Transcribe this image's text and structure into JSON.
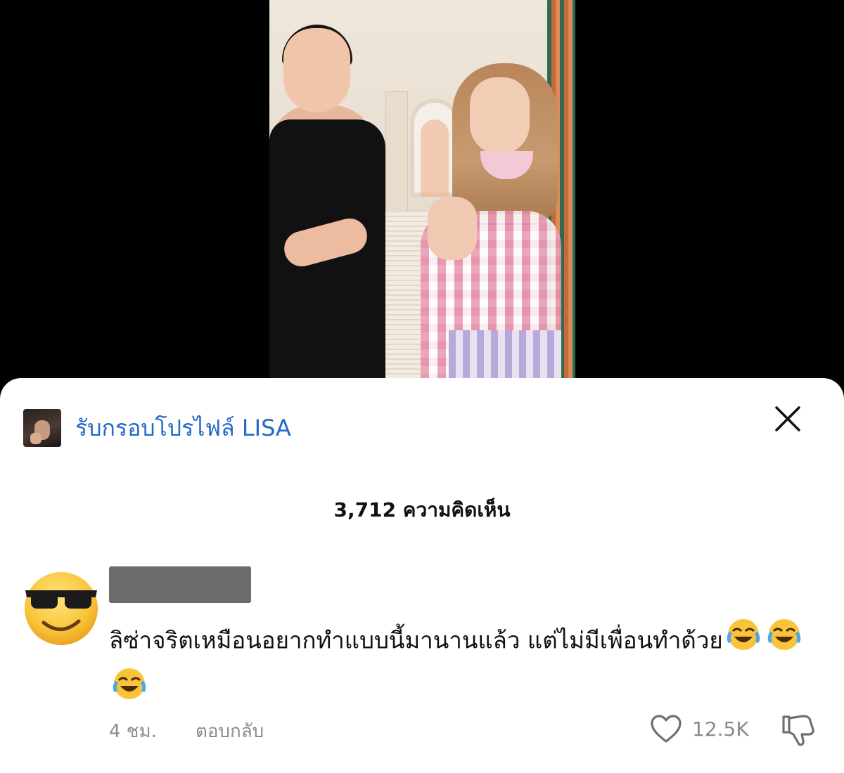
{
  "video": {
    "description_icon": "video-player"
  },
  "sheet": {
    "page_name": "รับกรอบโปรไฟล์ LISA",
    "comment_count_label": "3,712 ความคิดเห็น",
    "close_icon": "close-icon"
  },
  "comment": {
    "text": "ลิซ่าจริตเหมือนอยากทำแบบนี้มานานแล้ว แต่ไม่มีเพื่อนทำด้วย",
    "time": "4 ชม.",
    "reply_label": "ตอบกลับ",
    "like_count": "12.5K",
    "avatar_icon": "sunglasses-emoji",
    "reaction_icon": "laughing-emoji"
  },
  "colors": {
    "link_blue": "#2468c8",
    "meta_gray": "#8a8a8a"
  }
}
